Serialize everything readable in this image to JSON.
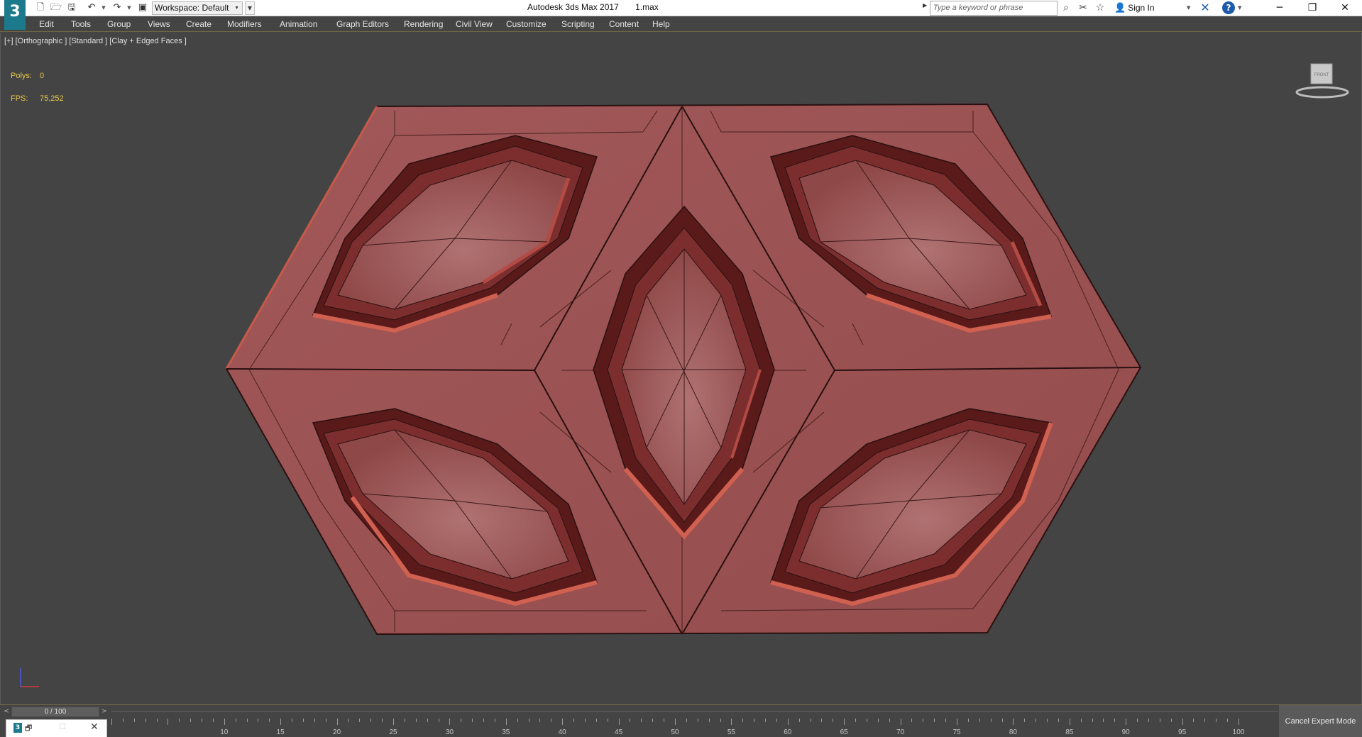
{
  "titlebar": {
    "app_logo": "3",
    "workspace": "Workspace: Default",
    "app_title": "Autodesk 3ds Max 2017",
    "file_name": "1.max",
    "search_placeholder": "Type a keyword or phrase",
    "sign_in": "Sign In",
    "win_minimize": "─",
    "win_restore": "❐",
    "win_close": "✕"
  },
  "menubar": {
    "items": [
      "Edit",
      "Tools",
      "Group",
      "Views",
      "Create",
      "Modifiers",
      "Animation",
      "Graph Editors",
      "Rendering",
      "Civil View",
      "Customize",
      "Scripting",
      "Content",
      "Help"
    ]
  },
  "viewport": {
    "label": "[+] [Orthographic ] [Standard ] [Clay + Edged Faces ]",
    "stats": {
      "polys_label": "Polys:",
      "polys_value": "0",
      "fps_label": "FPS:",
      "fps_value": "75,252"
    },
    "mesh_color": "#9a4f4f",
    "viewcube_label": "FRONT"
  },
  "timeline": {
    "slider_text": "0 / 100",
    "prev_arrow": "<",
    "next_arrow": ">",
    "tick_labels": [
      "10",
      "15",
      "20",
      "25",
      "30",
      "35",
      "40",
      "45",
      "50",
      "55",
      "60",
      "65",
      "70",
      "75",
      "80",
      "85",
      "90",
      "95",
      "100"
    ],
    "cancel_expert_mode": "Cancel Expert Mode"
  },
  "icons": {
    "new": "new-file-icon",
    "open": "open-file-icon",
    "save": "save-icon",
    "undo": "undo-icon",
    "redo": "redo-icon",
    "project": "project-folder-icon",
    "binoculars": "binoculars-icon",
    "communication": "communication-center-icon",
    "favorites": "star-icon",
    "user": "user-icon",
    "exchange": "autodesk-exchange-icon",
    "help": "help-icon"
  }
}
